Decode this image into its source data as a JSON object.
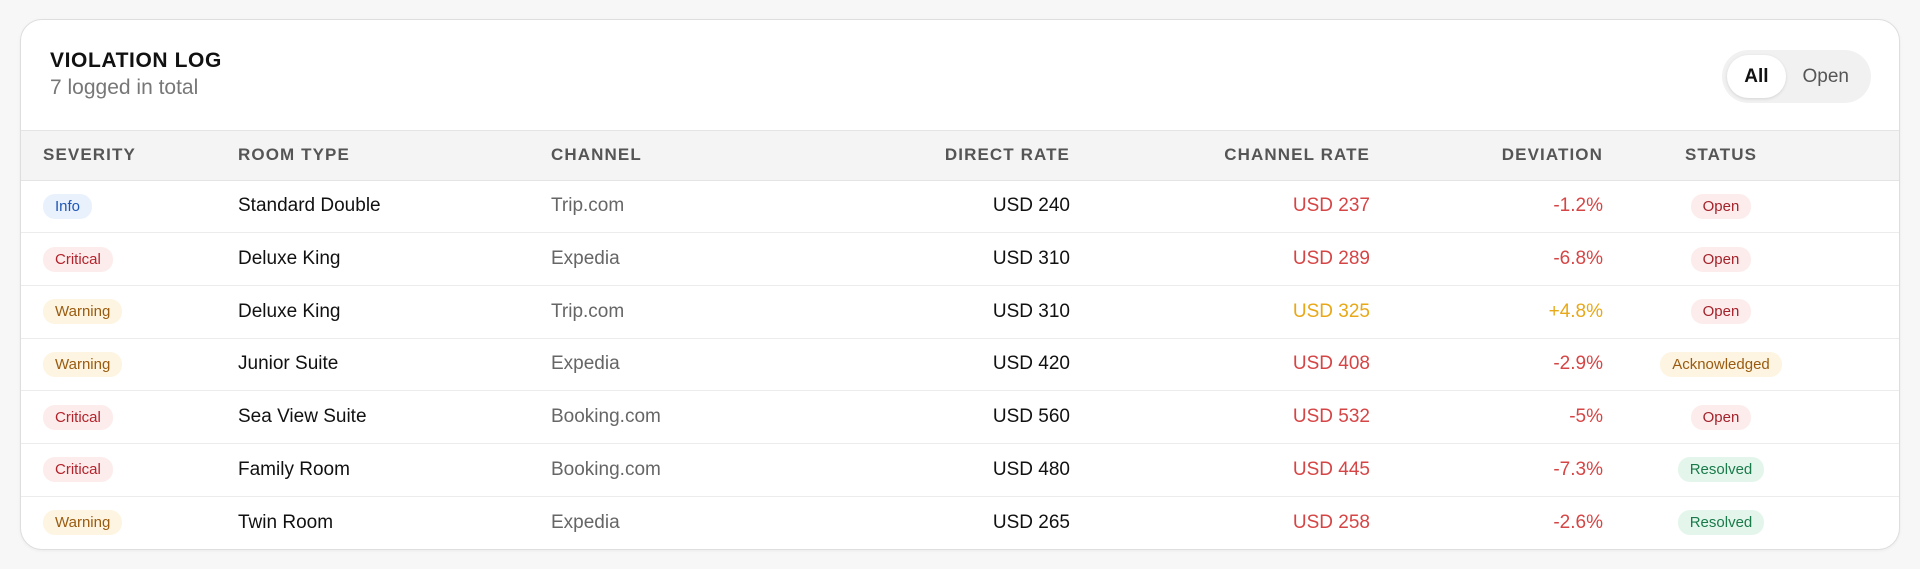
{
  "header": {
    "title": "VIOLATION LOG",
    "subtitle": "7 logged in total"
  },
  "filter": {
    "options": [
      "All",
      "Open"
    ],
    "selected": "All"
  },
  "table": {
    "columns": [
      "SEVERITY",
      "ROOM TYPE",
      "CHANNEL",
      "DIRECT RATE",
      "CHANNEL RATE",
      "DEVIATION",
      "STATUS"
    ],
    "rows": [
      {
        "severity": "Info",
        "room": "Standard Double",
        "channel": "Trip.com",
        "direct": "USD 240",
        "channel_rate": "USD 237",
        "deviation": "-1.2%",
        "status": "Open"
      },
      {
        "severity": "Critical",
        "room": "Deluxe King",
        "channel": "Expedia",
        "direct": "USD 310",
        "channel_rate": "USD 289",
        "deviation": "-6.8%",
        "status": "Open"
      },
      {
        "severity": "Warning",
        "room": "Deluxe King",
        "channel": "Trip.com",
        "direct": "USD 310",
        "channel_rate": "USD 325",
        "deviation": "+4.8%",
        "status": "Open"
      },
      {
        "severity": "Warning",
        "room": "Junior Suite",
        "channel": "Expedia",
        "direct": "USD 420",
        "channel_rate": "USD 408",
        "deviation": "-2.9%",
        "status": "Acknowledged"
      },
      {
        "severity": "Critical",
        "room": "Sea View Suite",
        "channel": "Booking.com",
        "direct": "USD 560",
        "channel_rate": "USD 532",
        "deviation": "-5%",
        "status": "Open"
      },
      {
        "severity": "Critical",
        "room": "Family Room",
        "channel": "Booking.com",
        "direct": "USD 480",
        "channel_rate": "USD 445",
        "deviation": "-7.3%",
        "status": "Resolved"
      },
      {
        "severity": "Warning",
        "room": "Twin Room",
        "channel": "Expedia",
        "direct": "USD 265",
        "channel_rate": "USD 258",
        "deviation": "-2.6%",
        "status": "Resolved"
      }
    ]
  },
  "colors": {
    "negative": "#d64545",
    "positive": "#e8a817"
  }
}
